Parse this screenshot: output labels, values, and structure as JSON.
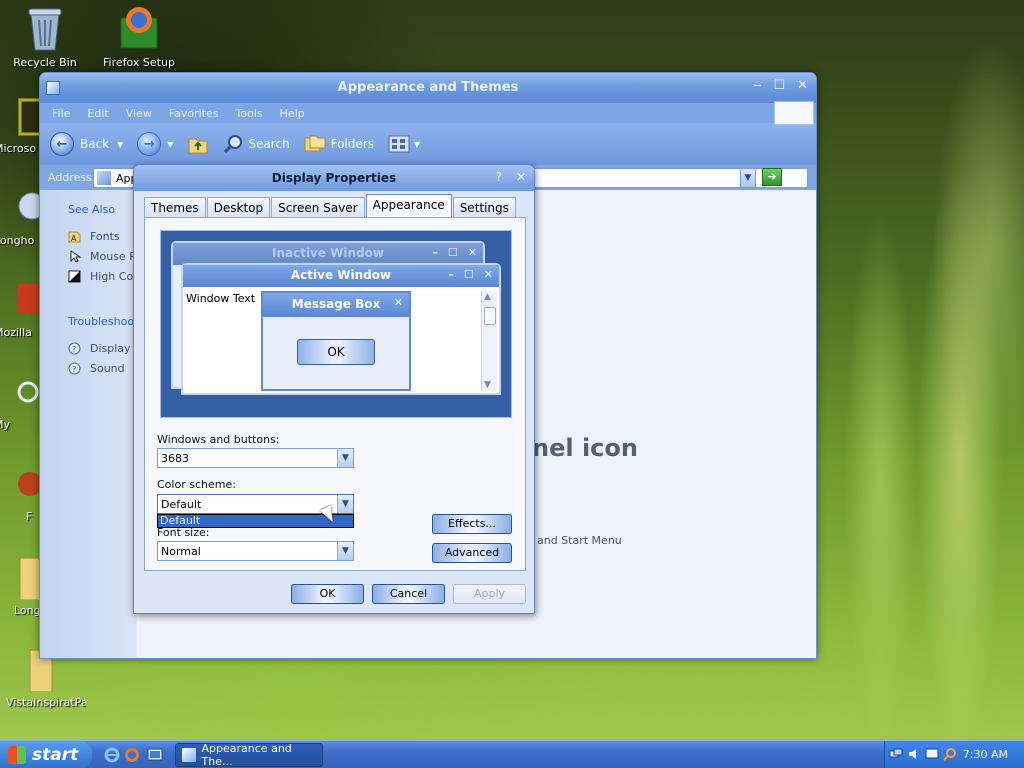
{
  "desktop": {
    "icons": [
      {
        "label": "Recycle Bin",
        "icon": "recycle-bin-icon"
      },
      {
        "label": "Firefox Setup",
        "icon": "firefox-setup-icon"
      },
      {
        "label": "Microso",
        "icon": "office-icon"
      },
      {
        "label": "Longho",
        "icon": "longhorn-icon"
      },
      {
        "label": "Mozilla",
        "icon": "mozilla-icon"
      },
      {
        "label": "My",
        "icon": "network-icon"
      },
      {
        "label": "F",
        "icon": "app-icon"
      },
      {
        "label": "Long",
        "icon": "folder-icon"
      },
      {
        "label": "VistaInspiratPack",
        "icon": "folder-icon"
      }
    ]
  },
  "window": {
    "title": "Appearance and Themes",
    "menu": [
      "File",
      "Edit",
      "View",
      "Favorites",
      "Tools",
      "Help"
    ],
    "toolbar": {
      "back": "Back",
      "search": "Search",
      "folders": "Folders"
    },
    "address": {
      "label": "Address",
      "value": "App",
      "go": "Go"
    },
    "sidebar": {
      "see_also_title": "See Also",
      "see_also": [
        "Fonts",
        "Mouse Po",
        "High Con"
      ],
      "troubleshoot_title": "Troubleshoo",
      "troubleshoot": [
        "Display",
        "Sound"
      ]
    },
    "background_heading": "nel icon",
    "background_link": "and Start Menu"
  },
  "dialog": {
    "title": "Display Properties",
    "help": "?",
    "tabs": [
      "Themes",
      "Desktop",
      "Screen Saver",
      "Appearance",
      "Settings"
    ],
    "active_tab": "Appearance",
    "preview": {
      "inactive_title": "Inactive Window",
      "active_title": "Active Window",
      "window_text": "Window Text",
      "msgbox_title": "Message Box",
      "msgbox_ok": "OK"
    },
    "windows_buttons_label": "Windows and buttons:",
    "windows_buttons_value": "3683",
    "color_scheme_label": "Color scheme:",
    "color_scheme_value": "Default",
    "color_scheme_options": [
      "Default"
    ],
    "font_size_label": "Font size:",
    "font_size_value": "Normal",
    "effects_button": "Effects...",
    "advanced_button": "Advanced",
    "ok_button": "OK",
    "cancel_button": "Cancel",
    "apply_button": "Apply"
  },
  "taskbar": {
    "start": "start",
    "task": "Appearance and The...",
    "clock": "7:30 AM"
  },
  "colors": {
    "accent": "#3168c6",
    "window_title_bar": "#6e9ce0",
    "taskbar": "#3e6fc8"
  }
}
